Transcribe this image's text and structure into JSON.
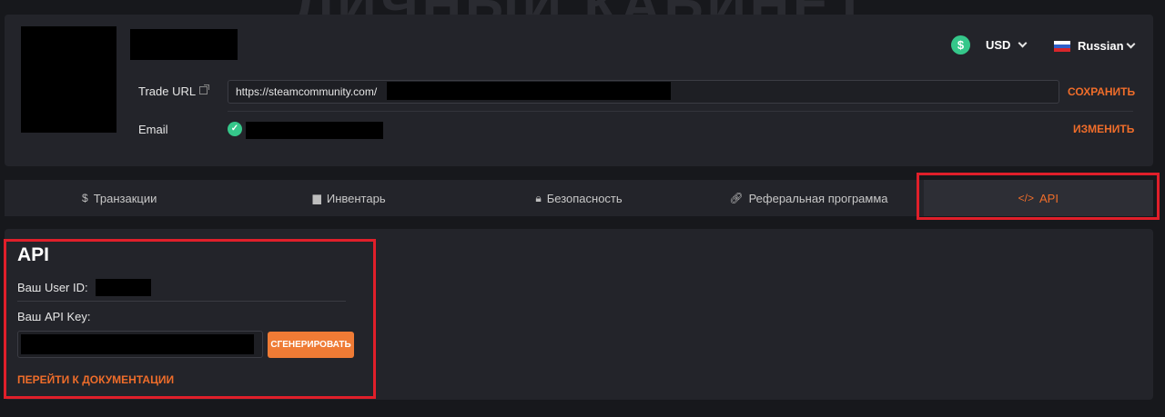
{
  "page": {
    "background_title": "ЛИЧНЫЙ КАБИНЕТ"
  },
  "header": {
    "currency": {
      "label": "USD",
      "icon": "dollar-icon",
      "color": "#35c78a"
    },
    "language": {
      "label": "Russian",
      "icon": "russia-flag-icon"
    }
  },
  "trade_url": {
    "label": "Trade URL",
    "value": "https://steamcommunity.com/",
    "action": "СОХРАНИТЬ"
  },
  "email": {
    "label": "Email",
    "verified_icon": "check-circle-icon",
    "action": "ИЗМЕНИТЬ"
  },
  "tabs": [
    {
      "label": "Транзакции",
      "icon": "$",
      "icon_name": "dollar-icon"
    },
    {
      "label": "Инвентарь",
      "icon": "▆",
      "icon_name": "inventory-box-icon"
    },
    {
      "label": "Безопасность",
      "icon": "🔒︎",
      "icon_name": "lock-icon"
    },
    {
      "label": "Реферальная программа",
      "icon": "🔗︎",
      "icon_name": "link-icon"
    },
    {
      "label": "API",
      "icon": "</>",
      "icon_name": "code-icon",
      "active": true
    }
  ],
  "api": {
    "title": "API",
    "user_id_label": "Ваш User ID:",
    "api_key_label": "Ваш API Key:",
    "generate_button": "СГЕНЕРИРОВАТЬ",
    "docs_link": "ПЕРЕЙТИ К ДОКУМЕНТАЦИИ"
  },
  "colors": {
    "accent": "#ef6d2a",
    "success": "#35c78a",
    "highlight": "#e01f2a",
    "panel": "#23242a",
    "background": "#17181c"
  }
}
